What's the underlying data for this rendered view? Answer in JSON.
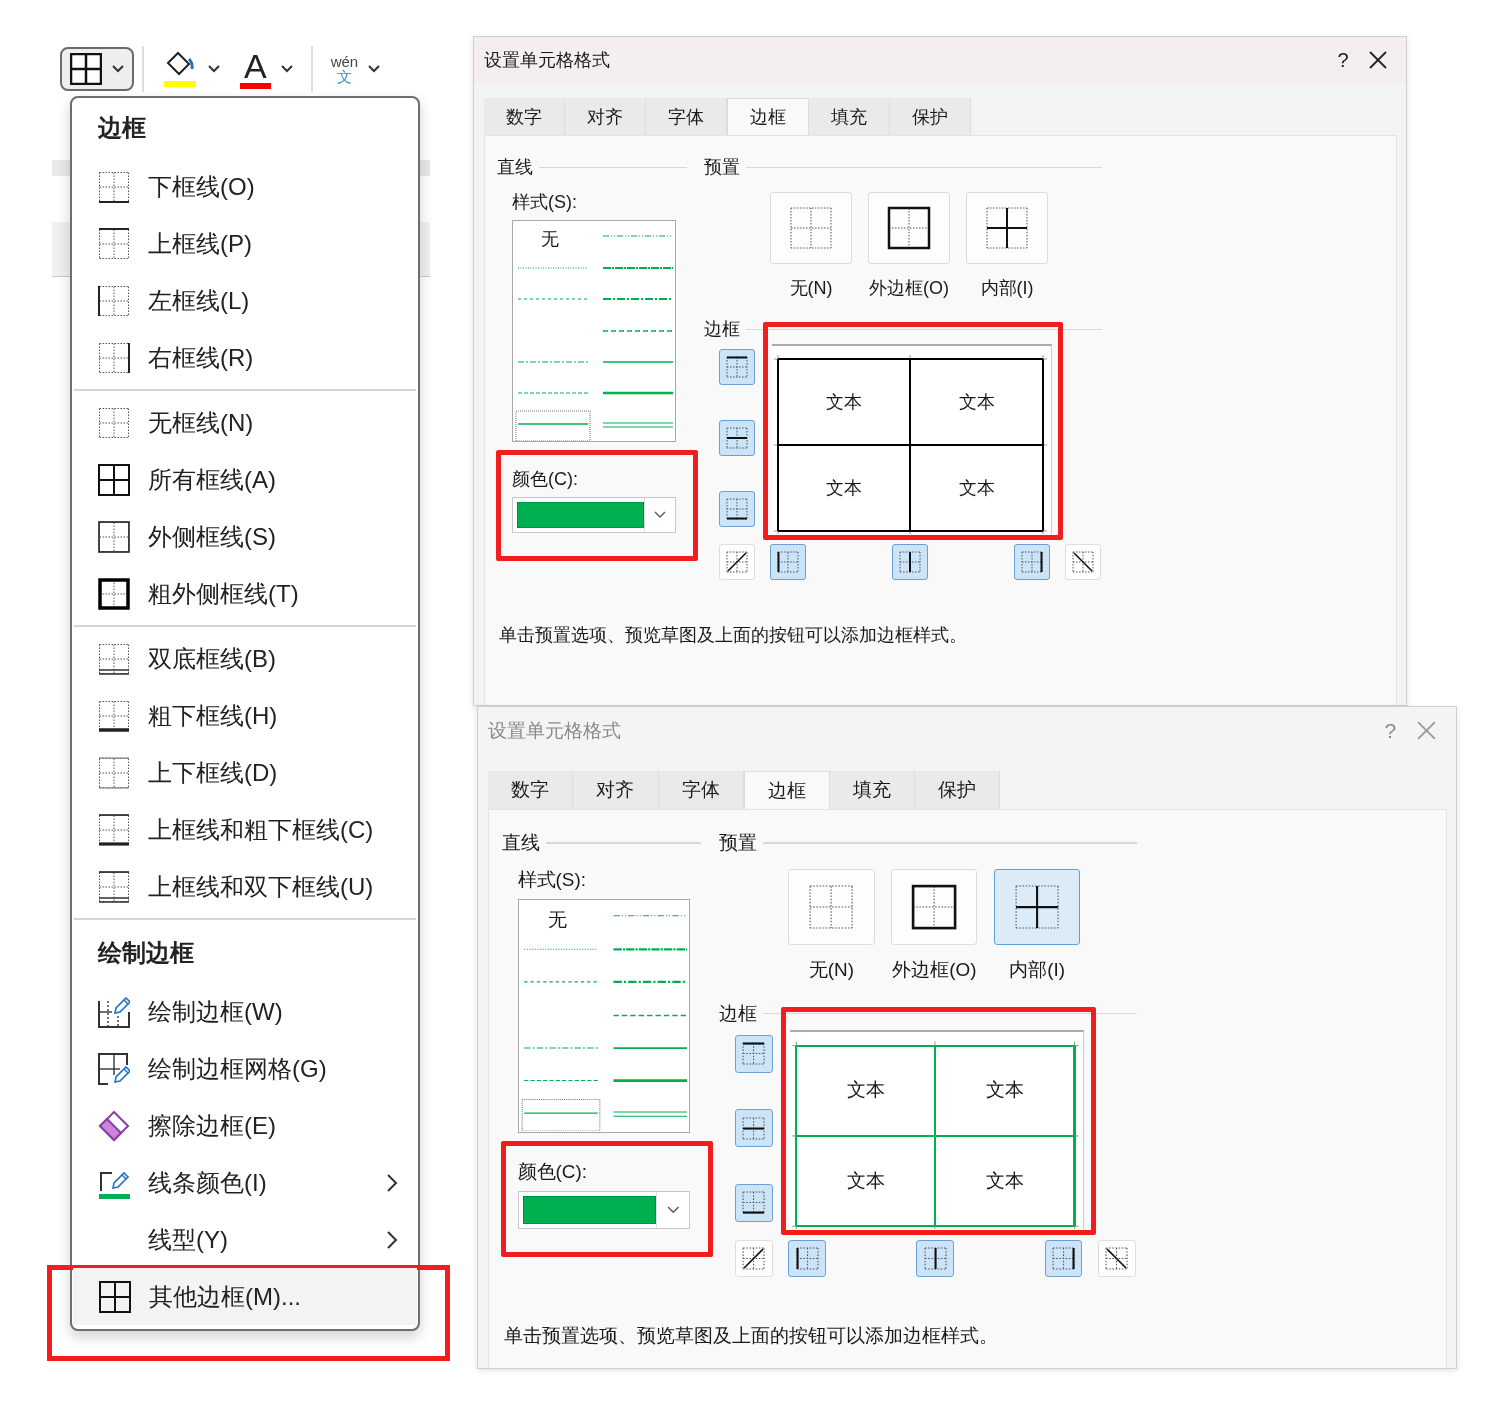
{
  "toolbar": {
    "items": [
      {
        "kind": "borders",
        "pressed": true
      },
      {
        "kind": "fill-color"
      },
      {
        "kind": "font-color",
        "glyph": "A"
      },
      {
        "kind": "phonetic",
        "pinyin": "wén",
        "char": "文"
      }
    ]
  },
  "border_menu": {
    "groups": [
      {
        "heading": "边框",
        "items": [
          {
            "label": "下框线(O)",
            "kind": "bottom",
            "submenu": false,
            "highlighted": false
          },
          {
            "label": "上框线(P)",
            "kind": "top",
            "submenu": false,
            "highlighted": false
          },
          {
            "label": "左框线(L)",
            "kind": "left",
            "submenu": false,
            "highlighted": false
          },
          {
            "label": "右框线(R)",
            "kind": "right",
            "submenu": false,
            "highlighted": false
          }
        ]
      },
      {
        "items": [
          {
            "label": "无框线(N)",
            "kind": "none",
            "submenu": false,
            "highlighted": false
          },
          {
            "label": "所有框线(A)",
            "kind": "all",
            "submenu": false,
            "highlighted": false
          },
          {
            "label": "外侧框线(S)",
            "kind": "outside",
            "submenu": false,
            "highlighted": false
          },
          {
            "label": "粗外侧框线(T)",
            "kind": "thick-outside",
            "submenu": false,
            "highlighted": false
          }
        ]
      },
      {
        "items": [
          {
            "label": "双底框线(B)",
            "kind": "double-bottom",
            "submenu": false,
            "highlighted": false
          },
          {
            "label": "粗下框线(H)",
            "kind": "thick-bottom",
            "submenu": false,
            "highlighted": false
          },
          {
            "label": "上下框线(D)",
            "kind": "top-bottom",
            "submenu": false,
            "highlighted": false
          },
          {
            "label": "上框线和粗下框线(C)",
            "kind": "top-thick-bottom",
            "submenu": false,
            "highlighted": false
          },
          {
            "label": "上框线和双下框线(U)",
            "kind": "top-double-bottom",
            "submenu": false,
            "highlighted": false
          }
        ]
      },
      {
        "heading": "绘制边框",
        "items": [
          {
            "label": "绘制边框(W)",
            "kind": "draw",
            "submenu": false,
            "highlighted": false
          },
          {
            "label": "绘制边框网格(G)",
            "kind": "draw-grid",
            "submenu": false,
            "highlighted": false
          },
          {
            "label": "擦除边框(E)",
            "kind": "erase",
            "submenu": false,
            "highlighted": false
          },
          {
            "label": "线条颜色(I)",
            "kind": "line-color",
            "submenu": true,
            "highlighted": false
          },
          {
            "label": "线型(Y)",
            "kind": "line-style",
            "submenu": true,
            "highlighted": false
          },
          {
            "label": "其他边框(M)...",
            "kind": "all",
            "submenu": false,
            "highlighted": true
          }
        ]
      }
    ]
  },
  "dialogs": [
    {
      "title": "设置单元格格式",
      "active": true,
      "help": "?",
      "tabs": [
        {
          "label": "数字",
          "selected": false
        },
        {
          "label": "对齐",
          "selected": false
        },
        {
          "label": "字体",
          "selected": false
        },
        {
          "label": "边框",
          "selected": true
        },
        {
          "label": "填充",
          "selected": false
        },
        {
          "label": "保护",
          "selected": false
        }
      ],
      "line_group": {
        "title": "直线",
        "style_label": "样式(S):",
        "style_none": "无",
        "color_label": "颜色(C):",
        "color": "#00b050",
        "highlighted": true
      },
      "presets": {
        "title": "预置",
        "items": [
          {
            "label": "无(N)",
            "kind": "none",
            "selected": false
          },
          {
            "label": "外边框(O)",
            "kind": "outline",
            "selected": false
          },
          {
            "label": "内部(I)",
            "kind": "inside",
            "selected": false
          }
        ]
      },
      "border": {
        "title": "边框",
        "highlighted": true,
        "color": "#000000",
        "cells": [
          "文本",
          "文本",
          "文本",
          "文本"
        ],
        "toggles": [
          {
            "kind": "top",
            "on": true
          },
          {
            "kind": "middle-h",
            "on": true
          },
          {
            "kind": "bottom",
            "on": true
          },
          {
            "kind": "diag-up",
            "on": false
          },
          {
            "kind": "left",
            "on": true
          },
          {
            "kind": "middle-v",
            "on": true
          },
          {
            "kind": "right",
            "on": true
          },
          {
            "kind": "diag-down",
            "on": false
          }
        ]
      },
      "hint": "单击预置选项、预览草图及上面的按钮可以添加边框样式。"
    },
    {
      "title": "设置单元格格式",
      "active": false,
      "help": "?",
      "tabs": [
        {
          "label": "数字",
          "selected": false
        },
        {
          "label": "对齐",
          "selected": false
        },
        {
          "label": "字体",
          "selected": false
        },
        {
          "label": "边框",
          "selected": true
        },
        {
          "label": "填充",
          "selected": false
        },
        {
          "label": "保护",
          "selected": false
        }
      ],
      "line_group": {
        "title": "直线",
        "style_label": "样式(S):",
        "style_none": "无",
        "color_label": "颜色(C):",
        "color": "#00b050",
        "highlighted": true
      },
      "presets": {
        "title": "预置",
        "items": [
          {
            "label": "无(N)",
            "kind": "none",
            "selected": false
          },
          {
            "label": "外边框(O)",
            "kind": "outline",
            "selected": false
          },
          {
            "label": "内部(I)",
            "kind": "inside",
            "selected": true
          }
        ]
      },
      "border": {
        "title": "边框",
        "highlighted": true,
        "color": "#00b050",
        "cells": [
          "文本",
          "文本",
          "文本",
          "文本"
        ],
        "toggles": [
          {
            "kind": "top",
            "on": true
          },
          {
            "kind": "middle-h",
            "on": true
          },
          {
            "kind": "bottom",
            "on": true
          },
          {
            "kind": "diag-up",
            "on": false
          },
          {
            "kind": "left",
            "on": true
          },
          {
            "kind": "middle-v",
            "on": true
          },
          {
            "kind": "right",
            "on": true
          },
          {
            "kind": "diag-down",
            "on": false
          }
        ]
      },
      "hint": "单击预置选项、预览草图及上面的按钮可以添加边框样式。"
    }
  ]
}
